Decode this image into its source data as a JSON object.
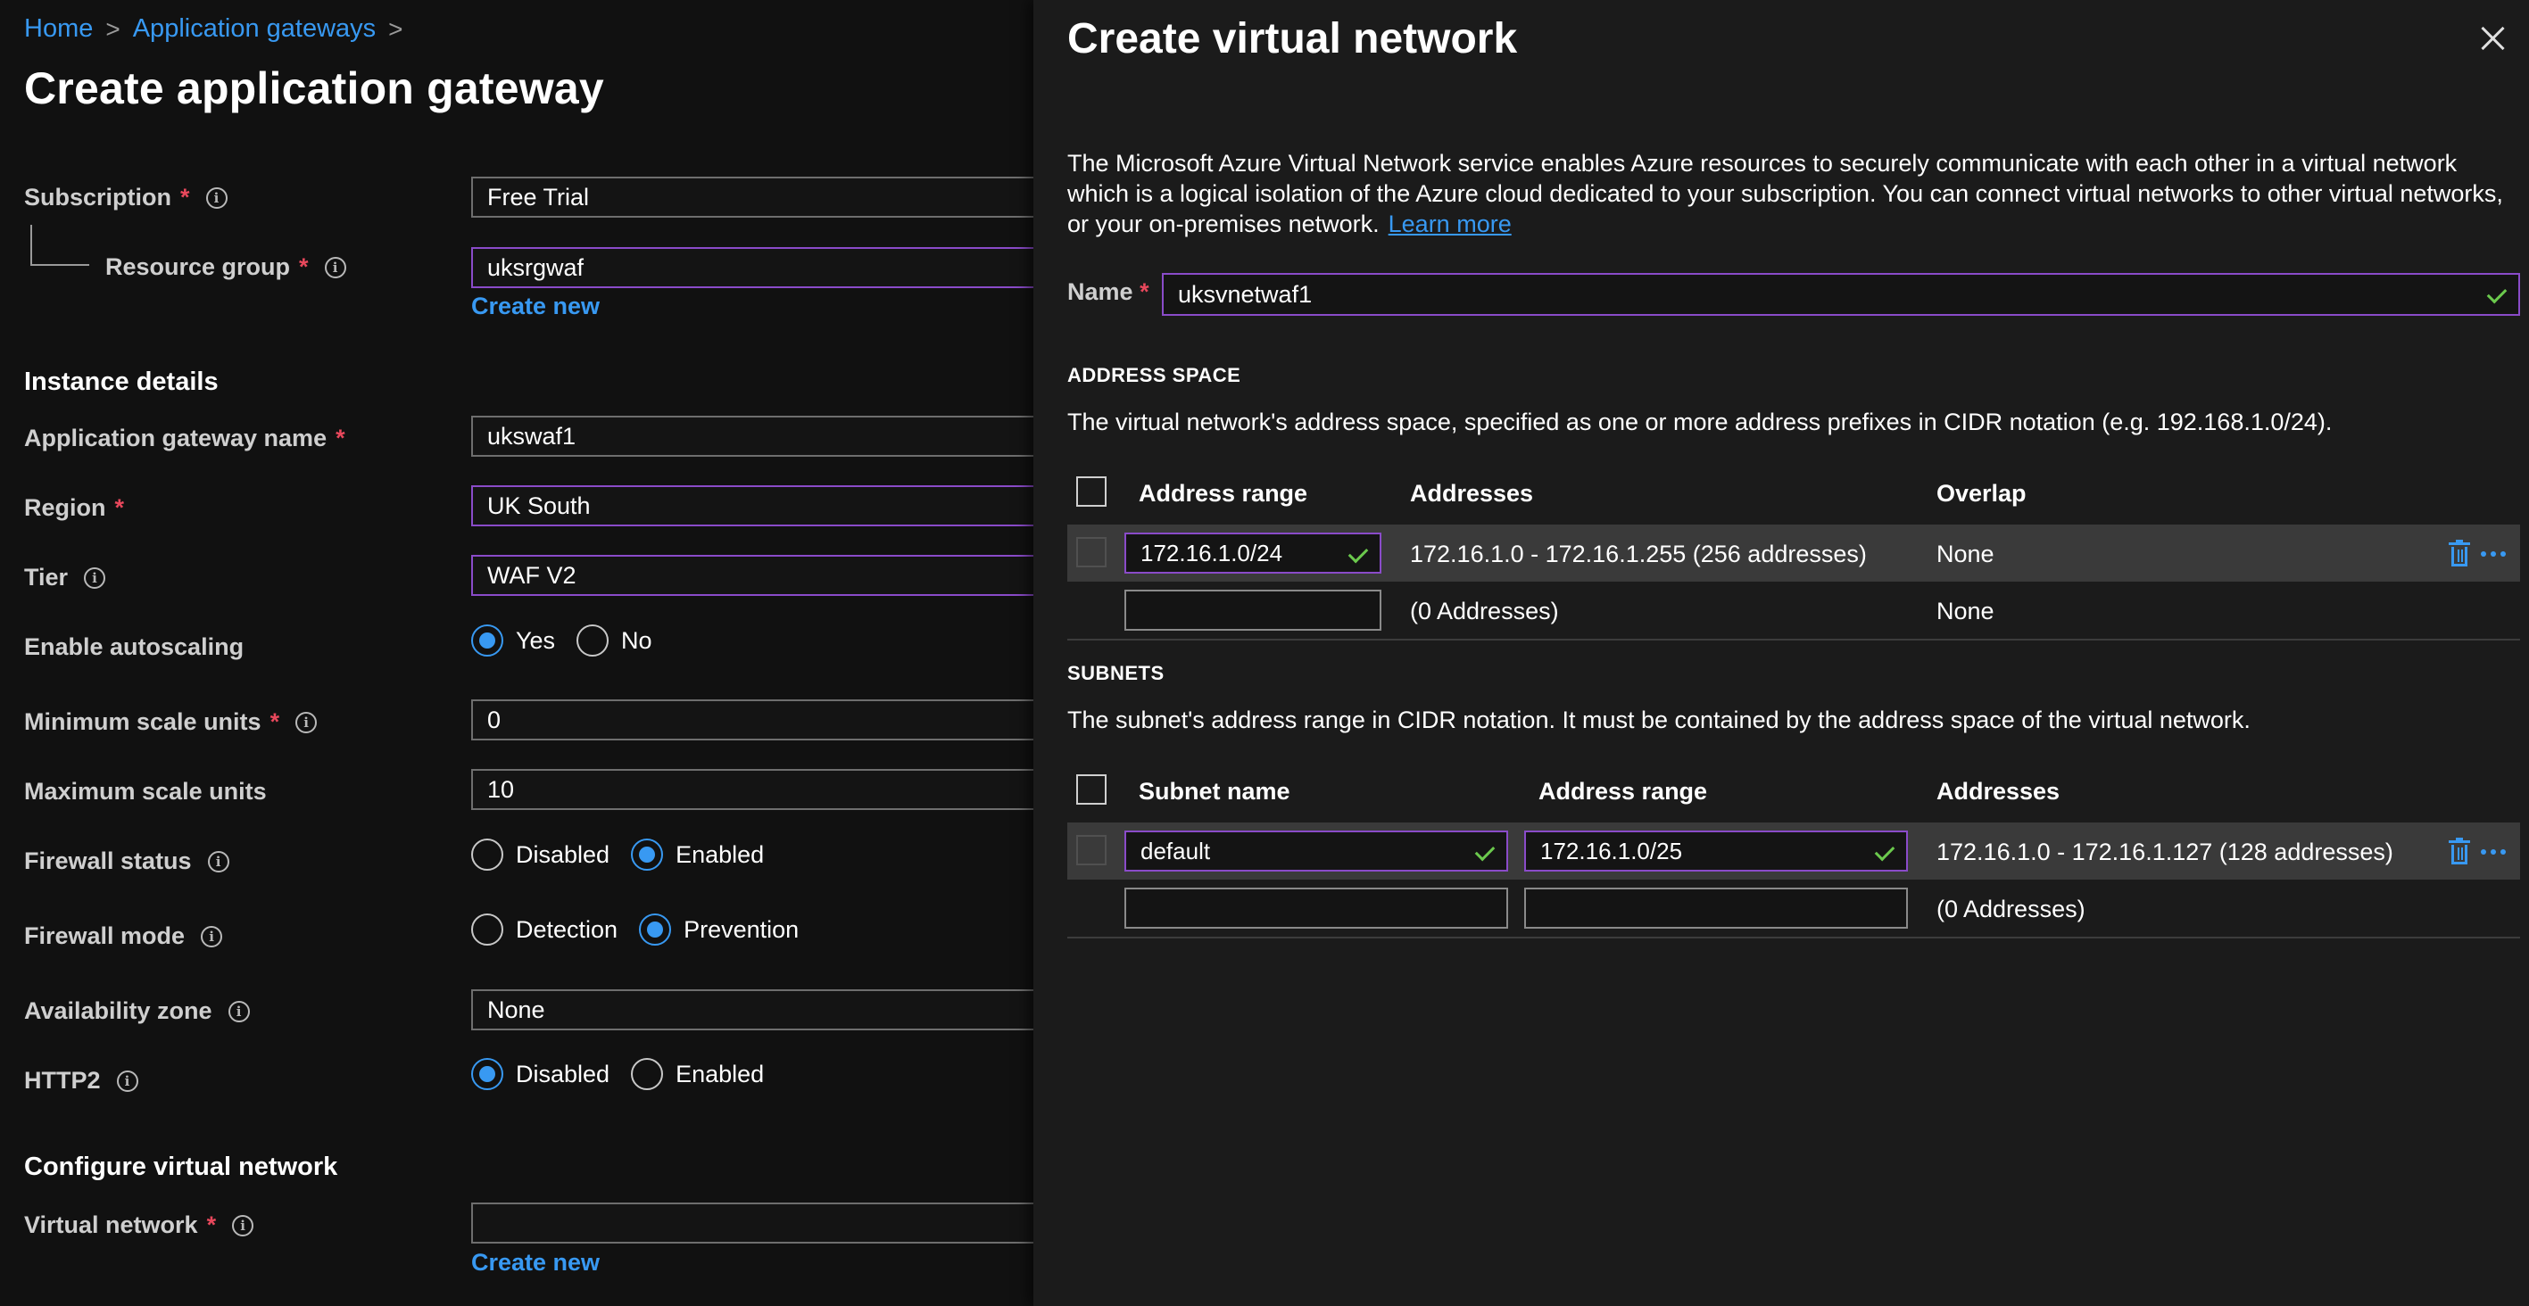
{
  "breadcrumb": {
    "home": "Home",
    "app_gateways": "Application gateways",
    "sep": ">"
  },
  "page": {
    "title": "Create application gateway"
  },
  "form": {
    "subscription": {
      "label": "Subscription",
      "value": "Free Trial"
    },
    "resource_group": {
      "label": "Resource group",
      "value": "uksrgwaf",
      "create_new": "Create new"
    },
    "instance_details": "Instance details",
    "gateway_name": {
      "label": "Application gateway name",
      "value": "ukswaf1"
    },
    "region": {
      "label": "Region",
      "value": "UK South"
    },
    "tier": {
      "label": "Tier",
      "value": "WAF V2"
    },
    "autoscaling": {
      "label": "Enable autoscaling",
      "options": [
        "Yes",
        "No"
      ],
      "selected": "Yes"
    },
    "min_scale": {
      "label": "Minimum scale units",
      "value": "0"
    },
    "max_scale": {
      "label": "Maximum scale units",
      "value": "10"
    },
    "firewall_status": {
      "label": "Firewall status",
      "options": [
        "Disabled",
        "Enabled"
      ],
      "selected": "Enabled"
    },
    "firewall_mode": {
      "label": "Firewall mode",
      "options": [
        "Detection",
        "Prevention"
      ],
      "selected": "Prevention"
    },
    "availability_zone": {
      "label": "Availability zone",
      "value": "None"
    },
    "http2": {
      "label": "HTTP2",
      "options": [
        "Disabled",
        "Enabled"
      ],
      "selected": "Disabled"
    },
    "configure_vnet": "Configure virtual network",
    "virtual_network": {
      "label": "Virtual network",
      "value": "",
      "create_new": "Create new"
    },
    "required_mark": "*",
    "info_glyph": "i"
  },
  "panel": {
    "title": "Create virtual network",
    "description": "The Microsoft Azure Virtual Network service enables Azure resources to securely communicate with each other in a virtual network which is a logical isolation of the Azure cloud dedicated to your subscription. You can connect virtual networks to other virtual networks, or your on-premises network.",
    "learn_more": "Learn more",
    "name_label": "Name",
    "name_value": "uksvnetwaf1",
    "address_space": {
      "heading": "ADDRESS SPACE",
      "note": "The virtual network's address space, specified as one or more address prefixes in CIDR notation (e.g. 192.168.1.0/24).",
      "columns": [
        "Address range",
        "Addresses",
        "Overlap"
      ],
      "rows": [
        {
          "range": "172.16.1.0/24",
          "addresses": "172.16.1.0 - 172.16.1.255 (256 addresses)",
          "overlap": "None"
        },
        {
          "range": "",
          "addresses": "(0 Addresses)",
          "overlap": "None"
        }
      ]
    },
    "subnets": {
      "heading": "SUBNETS",
      "note": "The subnet's address range in CIDR notation. It must be contained by the address space of the virtual network.",
      "columns": [
        "Subnet name",
        "Address range",
        "Addresses"
      ],
      "rows": [
        {
          "name": "default",
          "range": "172.16.1.0/25",
          "addresses": "172.16.1.0 - 172.16.1.127 (128 addresses)"
        },
        {
          "name": "",
          "range": "",
          "addresses": "(0 Addresses)"
        }
      ]
    }
  },
  "icons": {
    "close": "close-icon",
    "delete": "trash-icon",
    "more": "ellipsis-icon",
    "valid": "checkmark-icon",
    "info": "info-icon"
  },
  "colors": {
    "accent": "#3899f2",
    "required": "#e8485c",
    "focus_border": "#8a4bc9",
    "valid": "#6bc94d"
  }
}
